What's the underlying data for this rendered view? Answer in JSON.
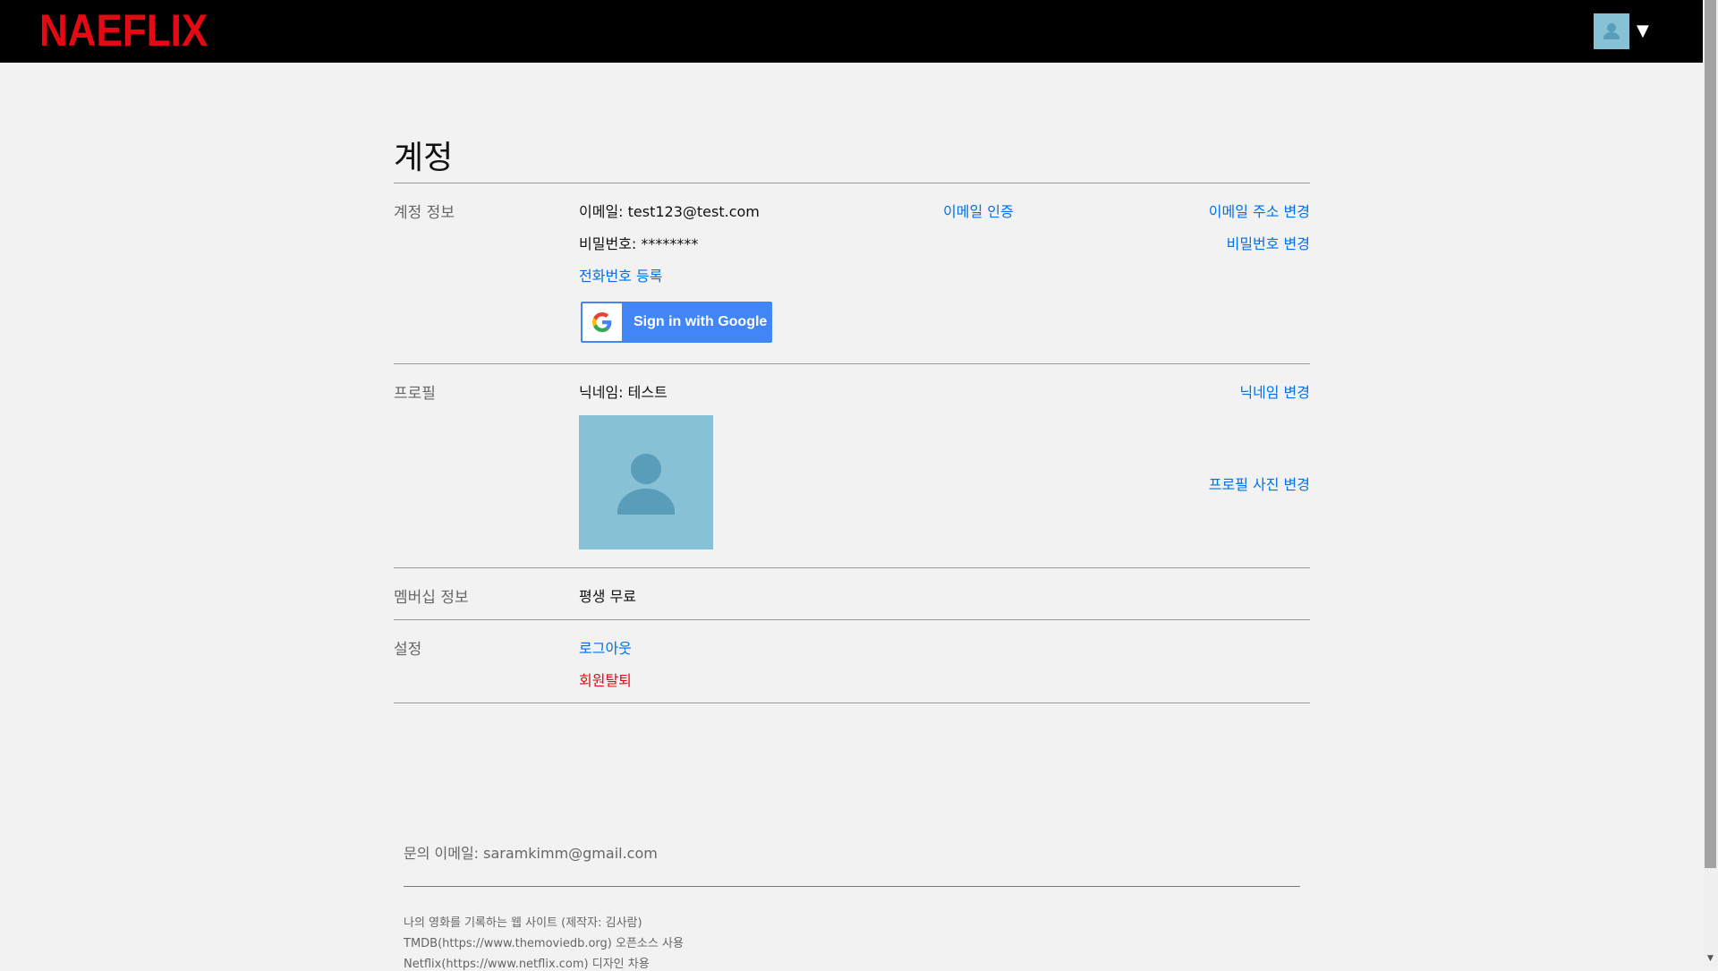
{
  "header": {
    "logo": "NAEFLIX",
    "user_menu_caret": "▼"
  },
  "page": {
    "title": "계정"
  },
  "account_info": {
    "label": "계정 정보",
    "email_line": "이메일: test123@test.com",
    "verify_email": "이메일 인증",
    "change_email": "이메일 주소 변경",
    "password_line": "비밀번호: ********",
    "change_password": "비밀번호 변경",
    "register_phone": "전화번호 등록",
    "google_button": "Sign in with Google"
  },
  "profile": {
    "label": "프로필",
    "nickname_line": "닉네임: 테스트",
    "change_nickname": "닉네임 변경",
    "change_photo": "프로필 사진 변경"
  },
  "membership": {
    "label": "멤버십 정보",
    "value": "평생 무료"
  },
  "settings": {
    "label": "설정",
    "logout": "로그아웃",
    "withdraw": "회원탈퇴"
  },
  "footer": {
    "contact": "문의 이메일: saramkimm@gmail.com",
    "lines": [
      "나의 영화를 기록하는 웹 사이트 (제작자: 김사람)",
      "TMDB(https://www.themoviedb.org) 오픈소스 사용",
      "Netflix(https://www.netflix.com) 디자인 차용"
    ]
  },
  "colors": {
    "brand": "#e50914",
    "link": "#0071eb",
    "avatar_bg": "#86c1d5",
    "google_blue": "#4285f4"
  },
  "icons": {
    "avatar": "user-silhouette-icon",
    "google": "google-g-icon",
    "caret": "caret-down-icon"
  }
}
